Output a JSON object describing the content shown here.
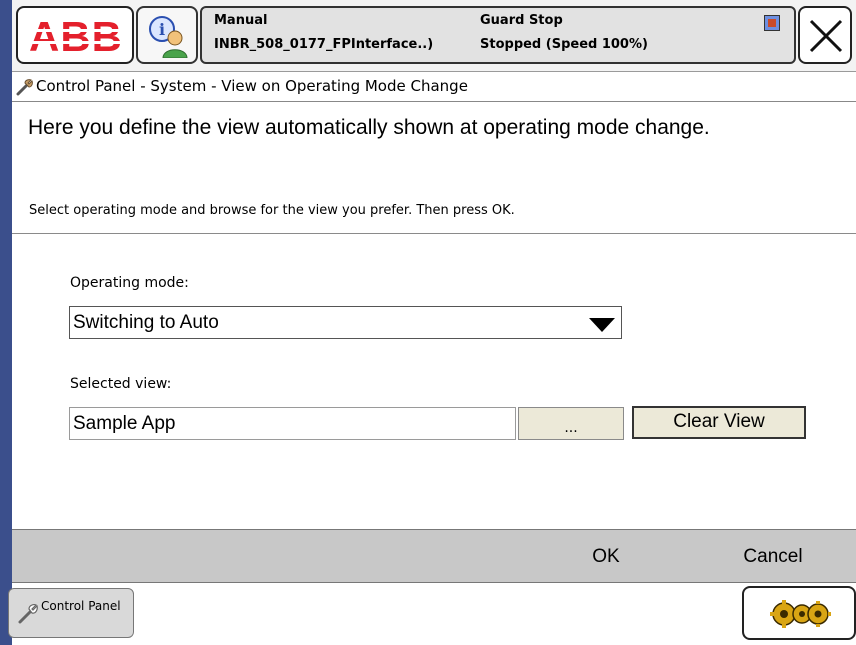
{
  "header": {
    "logo_text": "ABB",
    "status": {
      "mode": "Manual",
      "system_name": "INBR_508_0177_FPInterface..)",
      "guard": "Guard Stop",
      "state": "Stopped (Speed 100%)"
    }
  },
  "breadcrumb": {
    "text": "Control Panel - System - View on Operating Mode Change"
  },
  "description": {
    "title": "Here you define the view automatically shown at operating mode change.",
    "subtitle": "Select operating mode and browse for the view you prefer. Then press OK."
  },
  "form": {
    "operating_mode_label": "Operating mode:",
    "operating_mode_value": "Switching to Auto",
    "selected_view_label": "Selected view:",
    "selected_view_value": "Sample App",
    "browse_label": "...",
    "clear_view_label": "Clear View"
  },
  "command_bar": {
    "ok_label": "OK",
    "cancel_label": "Cancel"
  },
  "taskbar": {
    "control_panel_label": "Control Panel"
  },
  "colors": {
    "abb_red": "#e4202c",
    "edge_blue": "#3b4f8c",
    "command_bar_gray": "#c8c8c8",
    "button_beige": "#ece9d8"
  }
}
